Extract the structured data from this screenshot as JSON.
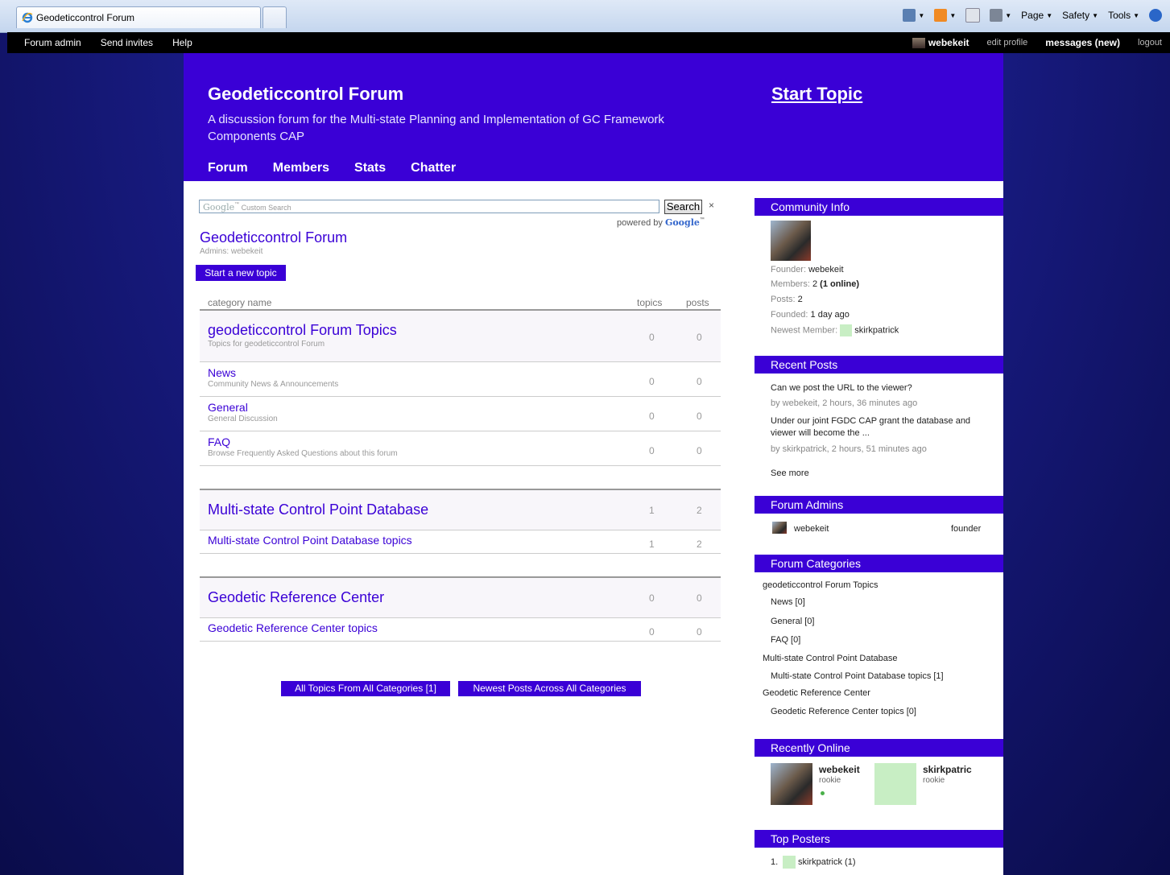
{
  "browser": {
    "tab_title": "Geodeticcontrol Forum",
    "cmd": {
      "page": "Page",
      "safety": "Safety",
      "tools": "Tools"
    }
  },
  "topbar": {
    "left": [
      "Forum admin",
      "Send invites",
      "Help"
    ],
    "user": "webekeit",
    "edit_profile": "edit profile",
    "messages": "messages (new)",
    "logout": "logout"
  },
  "header": {
    "title": "Geodeticcontrol Forum",
    "description": "A discussion forum for the Multi-state Planning and Implementation of GC Framework Components CAP",
    "start_topic": "Start Topic",
    "nav": [
      "Forum",
      "Members",
      "Stats",
      "Chatter"
    ]
  },
  "search": {
    "placeholder_brand": "Google",
    "placeholder_text": "Custom Search",
    "button": "Search",
    "close": "×",
    "powered_by": "powered by",
    "powered_brand": "Google"
  },
  "forum": {
    "title": "Geodeticcontrol Forum",
    "admins": "Admins: webekeit",
    "new_topic_button": "Start a new topic"
  },
  "table": {
    "headers": {
      "category": "category name",
      "topics": "topics",
      "posts": "posts"
    },
    "rows": [
      {
        "name": "geodeticcontrol Forum Topics",
        "desc": "Topics for geodeticcontrol Forum",
        "topics": "0",
        "posts": "0"
      },
      {
        "name": "News",
        "desc": "Community News & Announcements",
        "topics": "0",
        "posts": "0"
      },
      {
        "name": "General",
        "desc": "General Discussion",
        "topics": "0",
        "posts": "0"
      },
      {
        "name": "FAQ",
        "desc": "Browse Frequently Asked Questions about this forum",
        "topics": "0",
        "posts": "0"
      },
      {
        "name": "Multi-state Control Point Database",
        "desc": "",
        "topics": "1",
        "posts": "2"
      },
      {
        "name": "Multi-state Control Point Database topics",
        "desc": "",
        "topics": "1",
        "posts": "2"
      },
      {
        "name": "Geodetic Reference Center",
        "desc": "",
        "topics": "0",
        "posts": "0"
      },
      {
        "name": "Geodetic Reference Center topics",
        "desc": "",
        "topics": "0",
        "posts": "0"
      }
    ]
  },
  "bottom_buttons": {
    "all_topics": "All Topics From All Categories [1]",
    "newest_posts": "Newest Posts Across All Categories"
  },
  "sidebar": {
    "community": {
      "title": "Community Info",
      "founder_label": "Founder:",
      "founder": "webekeit",
      "members_label": "Members:",
      "members": "2",
      "members_online": "(1 online)",
      "posts_label": "Posts:",
      "posts": "2",
      "founded_label": "Founded:",
      "founded": "1 day ago",
      "newest_label": "Newest Member:",
      "newest": "skirkpatrick"
    },
    "recent_posts": {
      "title": "Recent Posts",
      "items": [
        {
          "text": "Can we post the URL to the viewer?",
          "meta": "by webekeit, 2 hours, 36 minutes ago"
        },
        {
          "text": "Under our joint FGDC CAP grant the database and viewer will become the ...",
          "meta": "by skirkpatrick, 2 hours, 51 minutes ago"
        }
      ],
      "see_more": "See more"
    },
    "admins": {
      "title": "Forum Admins",
      "name": "webekeit",
      "role": "founder"
    },
    "categories": {
      "title": "Forum Categories",
      "items": [
        "geodeticcontrol Forum Topics",
        "News [0]",
        "General [0]",
        "FAQ [0]",
        "Multi-state Control Point Database",
        "Multi-state Control Point Database topics [1]",
        "Geodetic Reference Center",
        "Geodetic Reference Center topics [0]"
      ]
    },
    "recently_online": {
      "title": "Recently Online",
      "users": [
        {
          "name": "webekeit",
          "rank": "rookie"
        },
        {
          "name": "skirkpatric",
          "rank": "rookie"
        }
      ]
    },
    "top_posters": {
      "title": "Top Posters",
      "rank": "1.",
      "name": "skirkpatrick (1)"
    }
  }
}
